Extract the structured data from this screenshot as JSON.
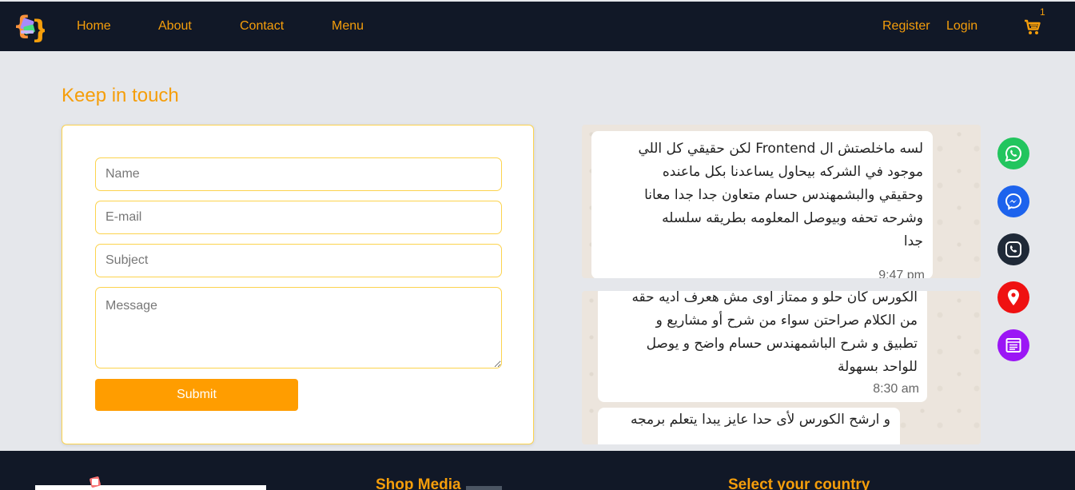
{
  "nav": {
    "links": [
      "Home",
      "About",
      "Contact",
      "Menu"
    ],
    "register": "Register",
    "login": "Login",
    "cart_count": "1"
  },
  "main": {
    "title": "Keep in touch",
    "form": {
      "name_placeholder": "Name",
      "email_placeholder": "E-mail",
      "subject_placeholder": "Subject",
      "message_placeholder": "Message",
      "submit_label": "Submit"
    },
    "testimonials": [
      {
        "lines": [
          "لسه ماخلصتش  ال Frontend لكن حقيقي كل اللي",
          "موجود في الشركه بيحاول يساعدنا بكل ماعنده",
          "وحقيقي والبشمهندس حسام متعاون جدا جدا معانا",
          "وشرحه تحفه وبيوصل المعلومه   بطريقه سلسله",
          "جدا"
        ],
        "time": "9:47 pm"
      },
      {
        "lines": [
          "الكورس كان حلو و ممتاز اوى مش هعرف اديه حقه",
          "من الكلام صراحتن سواء من شرح أو مشاريع و",
          "تطبيق و شرح الباشمهندس حسام واضح و يوصل",
          "للواحد بسهولة"
        ],
        "time": "8:30 am",
        "extra_line": "و ارشح الكورس لأى حدا عايز يبدا يتعلم برمجه"
      }
    ],
    "social_icons": [
      "whatsapp-icon",
      "messenger-icon",
      "phone-icon",
      "location-icon",
      "form-icon"
    ]
  },
  "footer": {
    "shop_heading": "Shop Media",
    "country_heading": "Select your country"
  },
  "colors": {
    "accent": "#f59e0b",
    "navbar": "#111827",
    "submit": "#ff9d00",
    "whatsapp": "#22c55e",
    "messenger": "#1d63ed",
    "phone": "#1f2937",
    "location": "#ef1111",
    "form": "#9b16f5"
  }
}
